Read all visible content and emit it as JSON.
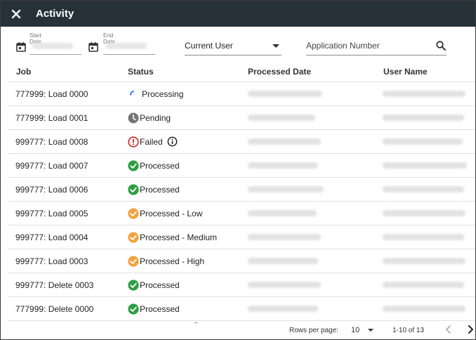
{
  "window": {
    "title": "Activity",
    "close_icon": "close-icon"
  },
  "filters": {
    "start_date": {
      "label": "Start Date",
      "icon": "calendar-icon"
    },
    "end_date": {
      "label": "End Date",
      "icon": "calendar-icon"
    },
    "user_select": {
      "value": "Current User",
      "icon": "caret-down-icon"
    },
    "application_search": {
      "placeholder": "Application Number",
      "icon": "search-icon"
    }
  },
  "table": {
    "headers": {
      "job": "Job",
      "status": "Status",
      "processed_date": "Processed Date",
      "user_name": "User Name"
    },
    "rows": [
      {
        "job": "777999: Load 0000",
        "status": "Processing",
        "status_icon": "spinner-icon"
      },
      {
        "job": "777999: Load 0001",
        "status": "Pending",
        "status_icon": "clock-icon"
      },
      {
        "job": "999777: Load 0008",
        "status": "Failed",
        "status_icon": "error-icon",
        "extra_icon": "info-icon"
      },
      {
        "job": "999777: Load 0007",
        "status": "Processed",
        "status_icon": "check-green-icon"
      },
      {
        "job": "999777: Load 0006",
        "status": "Processed",
        "status_icon": "check-green-icon"
      },
      {
        "job": "999777: Load 0005",
        "status": "Processed - Low",
        "status_icon": "check-orange-icon"
      },
      {
        "job": "999777: Load 0004",
        "status": "Processed - Medium",
        "status_icon": "check-orange-icon"
      },
      {
        "job": "999777: Load 0003",
        "status": "Processed - High",
        "status_icon": "check-orange-icon"
      },
      {
        "job": "999777: Delete 0003",
        "status": "Processed",
        "status_icon": "check-green-icon"
      },
      {
        "job": "777999: Delete 0000",
        "status": "Processed",
        "status_icon": "check-green-icon"
      }
    ]
  },
  "pagination": {
    "rows_per_page_label": "Rows per page:",
    "rows_per_page_value": "10",
    "range": "1-10 of 13",
    "prev_icon": "chevron-left-icon",
    "next_icon": "chevron-right-icon"
  },
  "colors": {
    "titlebar": "#263238",
    "processed": "#2e9e44",
    "processed_level": "#f0a340",
    "failed": "#c62828",
    "pending": "#757575",
    "processing": "#1e6fd9"
  }
}
